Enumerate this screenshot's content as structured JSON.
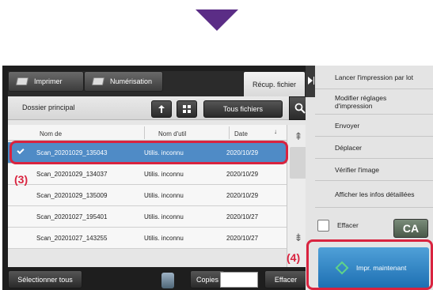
{
  "tabs": [
    {
      "label": "Imprimer"
    },
    {
      "label": "Numérisation"
    },
    {
      "label": "Récup. fichier"
    }
  ],
  "toolbar": {
    "folder": "Dossier principal",
    "all_files": "Tous fichiers"
  },
  "columns": [
    "Nom de",
    "Nom d'util",
    "Date"
  ],
  "files": [
    {
      "name": "Scan_20201029_135043",
      "user": "Utilis. inconnu",
      "date": "2020/10/29"
    },
    {
      "name": "Scan_20201029_134037",
      "user": "Utilis. inconnu",
      "date": "2020/10/29"
    },
    {
      "name": "Scan_20201029_135009",
      "user": "Utilis. inconnu",
      "date": "2020/10/29"
    },
    {
      "name": "Scan_20201027_195401",
      "user": "Utilis. inconnu",
      "date": "2020/10/27"
    },
    {
      "name": "Scan_20201027_143255",
      "user": "Utilis. inconnu",
      "date": "2020/10/27"
    }
  ],
  "bottom": {
    "select_all": "Sélectionner tous",
    "copies_label": "Copies",
    "delete": "Effacer"
  },
  "actions": [
    "Lancer l'impression par lot",
    "Modifier réglages d'impression",
    "Envoyer",
    "Déplacer",
    "Vérifier l'image",
    "Afficher les infos détaillées"
  ],
  "erase_label": "Effacer",
  "ca_label": "CA",
  "print_now": "Impr. maintenant",
  "callouts": {
    "row": "(3)",
    "button": "(4)"
  },
  "colors": {
    "callout": "#d9233f",
    "arrow": "#5b2d86",
    "selected_row": "#4f8bc6",
    "primary_button": "#1d6fb2"
  }
}
